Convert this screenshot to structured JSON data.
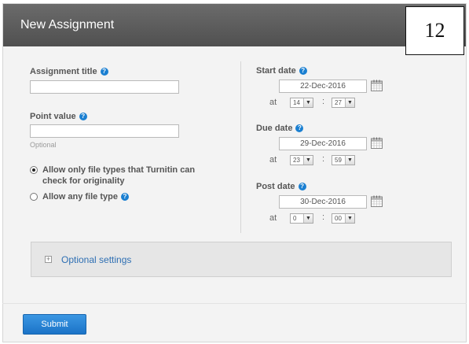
{
  "header": {
    "title": "New Assignment"
  },
  "annotation_number": "12",
  "left": {
    "assignment_title_label": "Assignment title",
    "assignment_title_value": "",
    "point_value_label": "Point value",
    "point_value_value": "",
    "point_value_hint": "Optional",
    "file_type_options": [
      {
        "label_line1": "Allow only file types that Turnitin can",
        "label_line2": "check for originality",
        "selected": true
      },
      {
        "label": "Allow any file type",
        "selected": false
      }
    ]
  },
  "right": {
    "at_label": "at",
    "colon": ":",
    "start": {
      "label": "Start date",
      "date": "22-Dec-2016",
      "hour": "14",
      "minute": "27"
    },
    "due": {
      "label": "Due date",
      "date": "29-Dec-2016",
      "hour": "23",
      "minute": "59"
    },
    "post": {
      "label": "Post date",
      "date": "30-Dec-2016",
      "hour": "0",
      "minute": "00"
    }
  },
  "optional_settings": {
    "label": "Optional settings",
    "expander_glyph": "+"
  },
  "submit": {
    "label": "Submit"
  },
  "icons": {
    "help": "help-icon",
    "calendar": "calendar-icon",
    "dropdown": "chevron-down-icon"
  },
  "colors": {
    "accent": "#1a7fd1",
    "header": "#5a5a5a",
    "submit": "#2483d6"
  }
}
